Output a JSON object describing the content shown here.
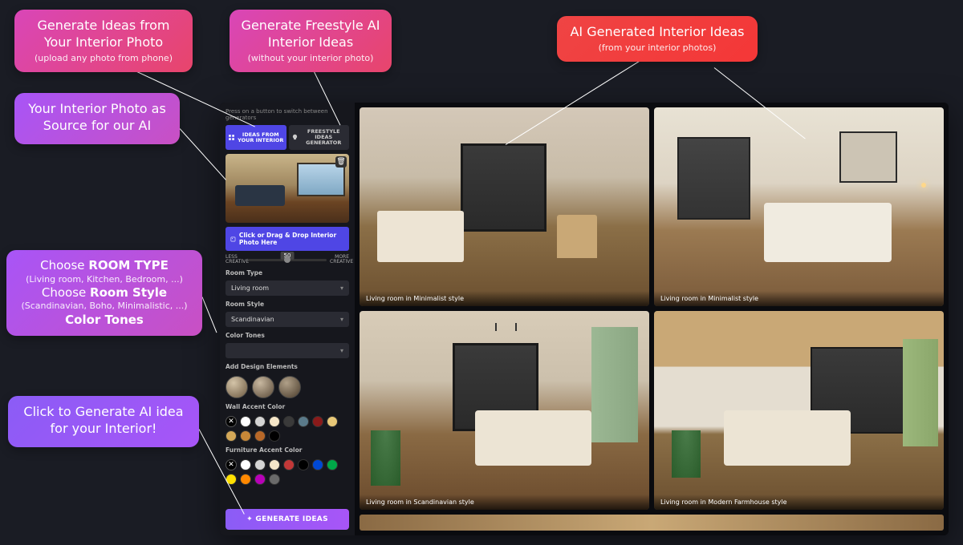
{
  "callouts": {
    "c1": {
      "title": "Generate Ideas from Your Interior Photo",
      "sub": "(upload any photo from phone)"
    },
    "c2": {
      "title": "Generate Freestyle AI Interior Ideas",
      "sub": "(without your interior photo)"
    },
    "c3": {
      "title": "AI Generated Interior Ideas",
      "sub": "(from your interior photos)"
    },
    "c4": {
      "title": "Your Interior Photo as Source for our AI"
    },
    "c5": {
      "line1": "Choose",
      "line1b": "ROOM TYPE",
      "sub1": "(Living room, Kitchen, Bedroom, ...)",
      "line2": "Choose",
      "line2b": "Room Style",
      "sub2": "(Scandinavian, Boho, Minimalistic, ...)",
      "line3": "Color Tones"
    },
    "c6": {
      "title": "Click to Generate AI idea for your Interior!"
    }
  },
  "sidebar": {
    "hint": "Press on a button to switch between generators",
    "tab1": "IDEAS FROM YOUR INTERIOR",
    "tab2": "FREESTYLE IDEAS GENERATOR",
    "upload": "Click or Drag & Drop Interior Photo Here",
    "slider": {
      "left": "LESS CREATIVE",
      "right": "MORE CREATIVE",
      "value": "50"
    },
    "roomTypeLabel": "Room Type",
    "roomTypeValue": "Living room",
    "roomStyleLabel": "Room Style",
    "roomStyleValue": "Scandinavian",
    "colorTonesLabel": "Color Tones",
    "colorTonesValue": "",
    "designElemsLabel": "Add Design Elements",
    "wallAccentLabel": "Wall Accent Color",
    "furnitureAccentLabel": "Furniture Accent Color",
    "generate": "✦ GENERATE IDEAS"
  },
  "colors": {
    "wall": [
      "none",
      "#ffffff",
      "#d4d4d4",
      "#f5e6c8",
      "#3a3a3a",
      "#5a7a8a",
      "#8a1a1a",
      "#e8c878",
      "#d4a858",
      "#c88838",
      "#b86828",
      "#000000"
    ],
    "furniture": [
      "none",
      "#ffffff",
      "#d4d4d4",
      "#f5e6c8",
      "#c23838",
      "#000000",
      "#0048d4",
      "#00a848",
      "#ffe000",
      "#ff8800",
      "#b800b8",
      "#6a6a6a"
    ]
  },
  "gallery": {
    "cards": [
      {
        "caption": "Living room in Minimalist style"
      },
      {
        "caption": "Living room in Minimalist style"
      },
      {
        "caption": "Living room in Scandinavian style"
      },
      {
        "caption": "Living room in Modern Farmhouse style"
      }
    ]
  }
}
